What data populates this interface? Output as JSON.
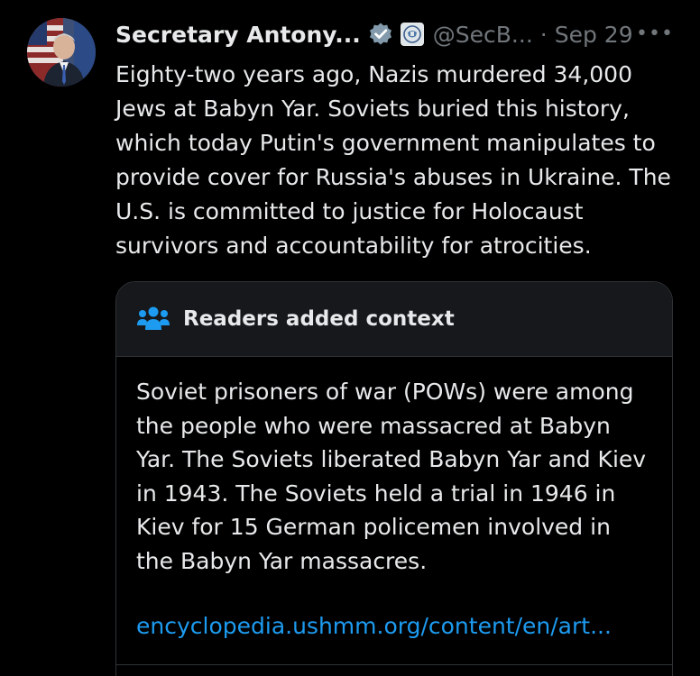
{
  "tweet": {
    "display_name": "Secretary Antony...",
    "handle": "@SecB...",
    "separator": "·",
    "date": "Sep 29",
    "more_label": "•••",
    "text": "Eighty-two years ago, Nazis murdered 34,000 Jews at Babyn Yar. Soviets buried this history, which today Putin's government manipulates to provide cover for Russia's abuses in Ukraine. The U.S. is committed to justice for Holocaust survivors and accountability for atrocities."
  },
  "community_note": {
    "title": "Readers added context",
    "body": "Soviet prisoners of war (POWs) were among the people who were massacred at Babyn Yar. The Soviets liberated Babyn Yar and Kiev in 1943. The Soviets held a trial in 1946 in Kiev for 15 German policemen involved in the Babyn Yar massacres.",
    "link": "encyclopedia.ushmm.org/content/en/art..."
  },
  "icons": {
    "verified": "verified-badge-icon",
    "government": "government-affiliation-icon",
    "note": "people-group-icon"
  },
  "colors": {
    "background": "#000000",
    "text": "#e7e9ea",
    "muted": "#71767b",
    "link": "#1d9bf0",
    "note_header_bg": "#16181c",
    "border": "#2f3336"
  }
}
